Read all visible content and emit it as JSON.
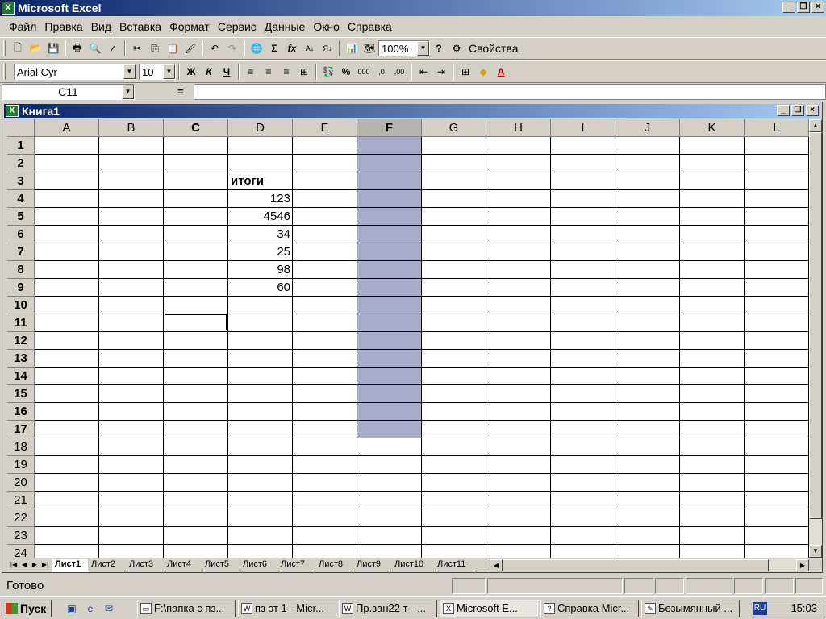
{
  "window": {
    "title": "Microsoft Excel",
    "minimize": "_",
    "restore": "❐",
    "close": "×"
  },
  "menu": [
    "Файл",
    "Правка",
    "Вид",
    "Вставка",
    "Формат",
    "Сервис",
    "Данные",
    "Окно",
    "Справка"
  ],
  "toolbar": {
    "zoom": "100%",
    "properties_label": "Свойства"
  },
  "format_toolbar": {
    "font": "Arial Cyr",
    "size": "10",
    "bold": "Ж",
    "italic": "К",
    "underline": "Ч"
  },
  "formula": {
    "cell_ref": "C11",
    "eq": "="
  },
  "workbook": {
    "title": "Книга1"
  },
  "columns": [
    "A",
    "B",
    "C",
    "D",
    "E",
    "F",
    "G",
    "H",
    "I",
    "J",
    "K",
    "L"
  ],
  "rows": [
    "1",
    "2",
    "3",
    "4",
    "5",
    "6",
    "7",
    "8",
    "9",
    "10",
    "11",
    "12",
    "13",
    "14",
    "15",
    "16",
    "17",
    "18",
    "19",
    "20",
    "21",
    "22",
    "23",
    "24"
  ],
  "cells": {
    "d3": "итоги",
    "d4": "123",
    "d5": "4546",
    "d6": "34",
    "d7": "25",
    "d8": "98",
    "d9": "60"
  },
  "sheets": [
    "Лист1",
    "Лист2",
    "Лист3",
    "Лист4",
    "Лист5",
    "Лист6",
    "Лист7",
    "Лист8",
    "Лист9",
    "Лист10",
    "Лист11"
  ],
  "status": {
    "text": "Готово"
  },
  "taskbar": {
    "start": "Пуск",
    "tasks": [
      "F:\\папка с пз...",
      "пз эт 1 - Micr...",
      "Пр.зан22 т - ...",
      "Microsoft E...",
      "Справка Micr...",
      "Безымянный ..."
    ],
    "lang": "RU",
    "clock": "15:03"
  }
}
